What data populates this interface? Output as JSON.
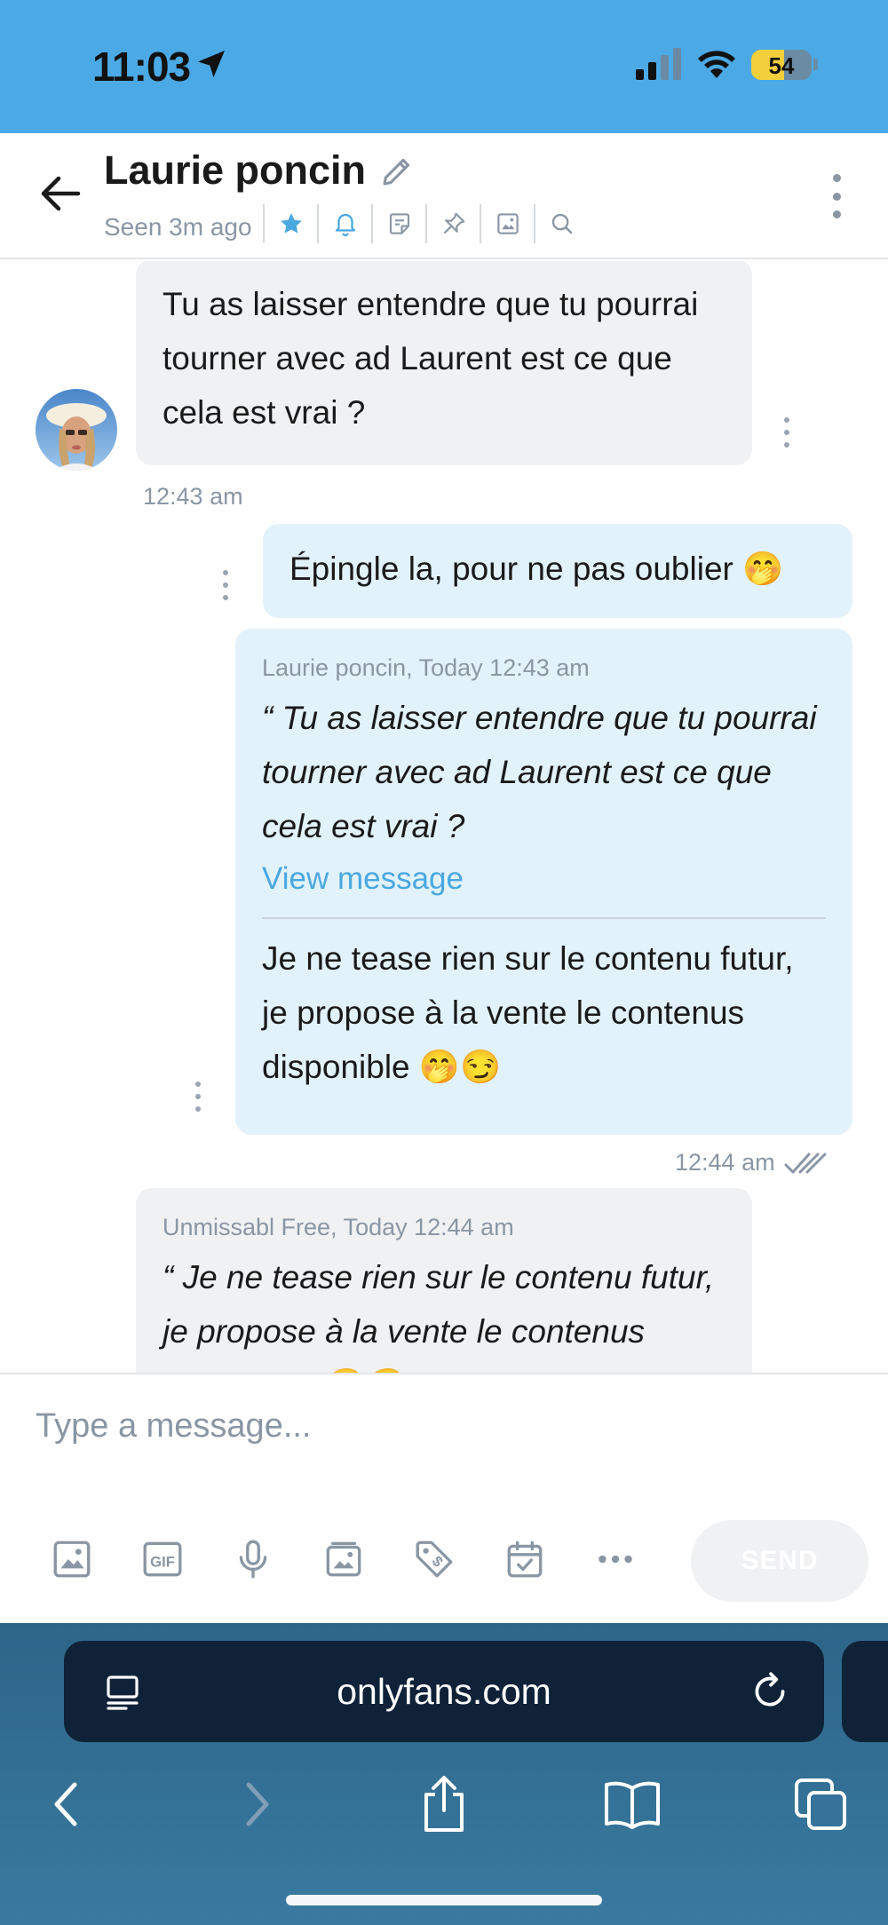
{
  "status_bar": {
    "time": "11:03",
    "battery": "54",
    "battery_level": 0.54
  },
  "header": {
    "name": "Laurie poncin",
    "seen": "Seen 3m ago",
    "tools": [
      "star-icon",
      "bell-icon",
      "note-icon",
      "pin-icon",
      "image-icon",
      "search-icon"
    ]
  },
  "messages": {
    "msg1": {
      "text": "Tu as laisser entendre que tu pourrai tourner avec ad Laurent est ce que cela est vrai ?",
      "time": "12:43 am"
    },
    "msg2": {
      "text": "Épingle la, pour ne pas oublier 🤭"
    },
    "msg3": {
      "quote_meta": "Laurie poncin, Today 12:43 am",
      "quote_text": "“ Tu as laisser entendre que tu pourrai tourner avec ad Laurent est ce que cela est vrai ?",
      "view_message": "View message",
      "text": "Je ne tease rien sur le contenu futur, je propose à la vente le contenus disponible 🤭😏",
      "time": "12:44 am"
    },
    "msg4": {
      "quote_meta": "Unmissabl Free, Today 12:44 am",
      "quote_text": "“ Je ne tease rien sur le contenu futur, je propose à la vente le contenus disponible 🤭😏"
    }
  },
  "composer": {
    "placeholder": "Type a message...",
    "send_label": "SEND",
    "tools": [
      "image-icon",
      "gif-icon",
      "microphone-icon",
      "vault-icon",
      "price-tag-icon",
      "calendar-icon",
      "more-icon"
    ]
  },
  "browser": {
    "url": "onlyfans.com"
  },
  "colors": {
    "status_bar": "#4ba9e6",
    "accent": "#4aa8e0",
    "incoming_bubble": "#f0f1f3",
    "outgoing_bubble": "#e2f2fb",
    "browser_url_bar": "#0f2238"
  }
}
